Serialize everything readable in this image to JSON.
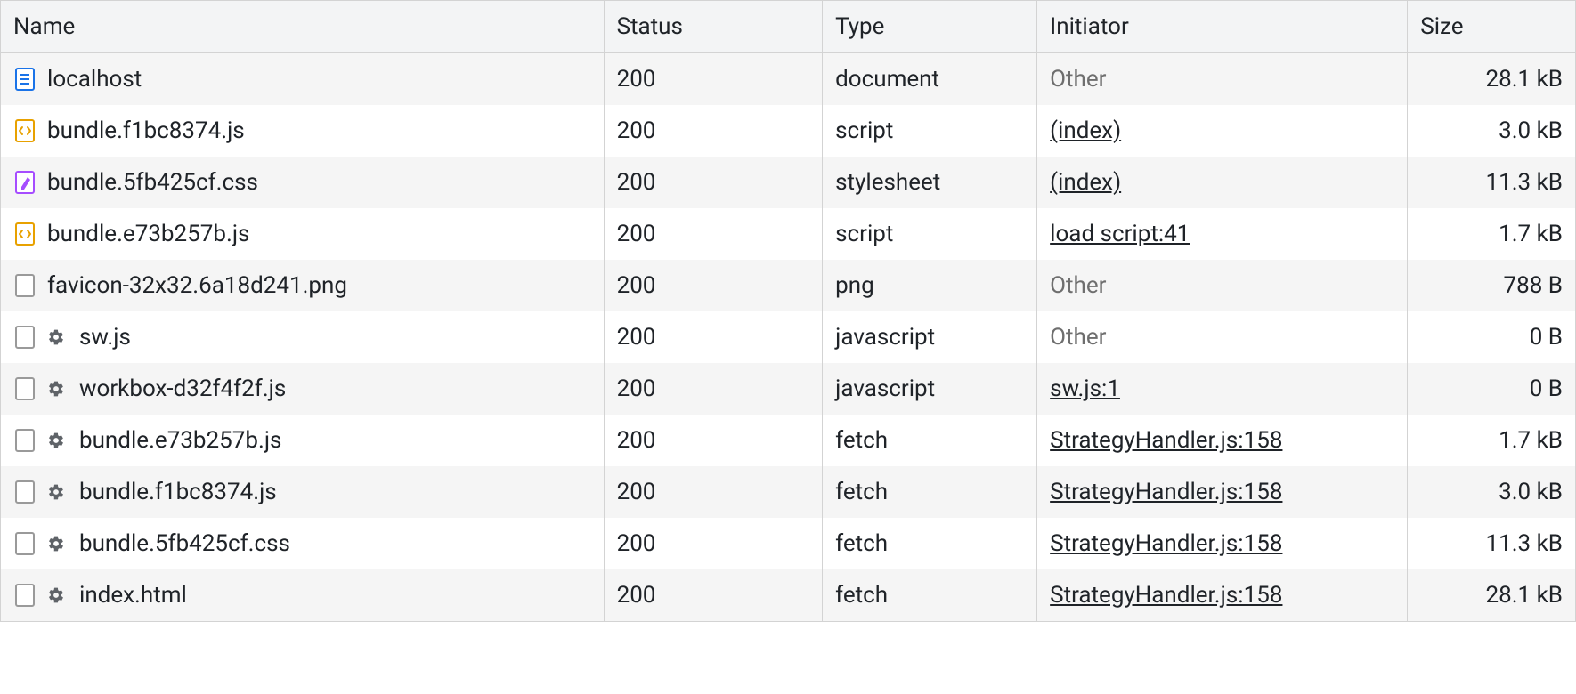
{
  "columns": {
    "name": "Name",
    "status": "Status",
    "type": "Type",
    "initiator": "Initiator",
    "size": "Size"
  },
  "rows": [
    {
      "icon": "document",
      "gear": false,
      "name": "localhost",
      "status": "200",
      "type": "document",
      "initiator": "Other",
      "initiator_link": false,
      "size": "28.1 kB"
    },
    {
      "icon": "script",
      "gear": false,
      "name": "bundle.f1bc8374.js",
      "status": "200",
      "type": "script",
      "initiator": "(index)",
      "initiator_link": true,
      "size": "3.0 kB"
    },
    {
      "icon": "style",
      "gear": false,
      "name": "bundle.5fb425cf.css",
      "status": "200",
      "type": "stylesheet",
      "initiator": "(index)",
      "initiator_link": true,
      "size": "11.3 kB"
    },
    {
      "icon": "script",
      "gear": false,
      "name": "bundle.e73b257b.js",
      "status": "200",
      "type": "script",
      "initiator": "load script:41",
      "initiator_link": true,
      "size": "1.7 kB"
    },
    {
      "icon": "file",
      "gear": false,
      "name": "favicon-32x32.6a18d241.png",
      "status": "200",
      "type": "png",
      "initiator": "Other",
      "initiator_link": false,
      "size": "788 B"
    },
    {
      "icon": "file",
      "gear": true,
      "name": "sw.js",
      "status": "200",
      "type": "javascript",
      "initiator": "Other",
      "initiator_link": false,
      "size": "0 B"
    },
    {
      "icon": "file",
      "gear": true,
      "name": "workbox-d32f4f2f.js",
      "status": "200",
      "type": "javascript",
      "initiator": "sw.js:1",
      "initiator_link": true,
      "size": "0 B"
    },
    {
      "icon": "file",
      "gear": true,
      "name": "bundle.e73b257b.js",
      "status": "200",
      "type": "fetch",
      "initiator": "StrategyHandler.js:158",
      "initiator_link": true,
      "size": "1.7 kB"
    },
    {
      "icon": "file",
      "gear": true,
      "name": "bundle.f1bc8374.js",
      "status": "200",
      "type": "fetch",
      "initiator": "StrategyHandler.js:158",
      "initiator_link": true,
      "size": "3.0 kB"
    },
    {
      "icon": "file",
      "gear": true,
      "name": "bundle.5fb425cf.css",
      "status": "200",
      "type": "fetch",
      "initiator": "StrategyHandler.js:158",
      "initiator_link": true,
      "size": "11.3 kB"
    },
    {
      "icon": "file",
      "gear": true,
      "name": "index.html",
      "status": "200",
      "type": "fetch",
      "initiator": "StrategyHandler.js:158",
      "initiator_link": true,
      "size": "28.1 kB"
    }
  ]
}
